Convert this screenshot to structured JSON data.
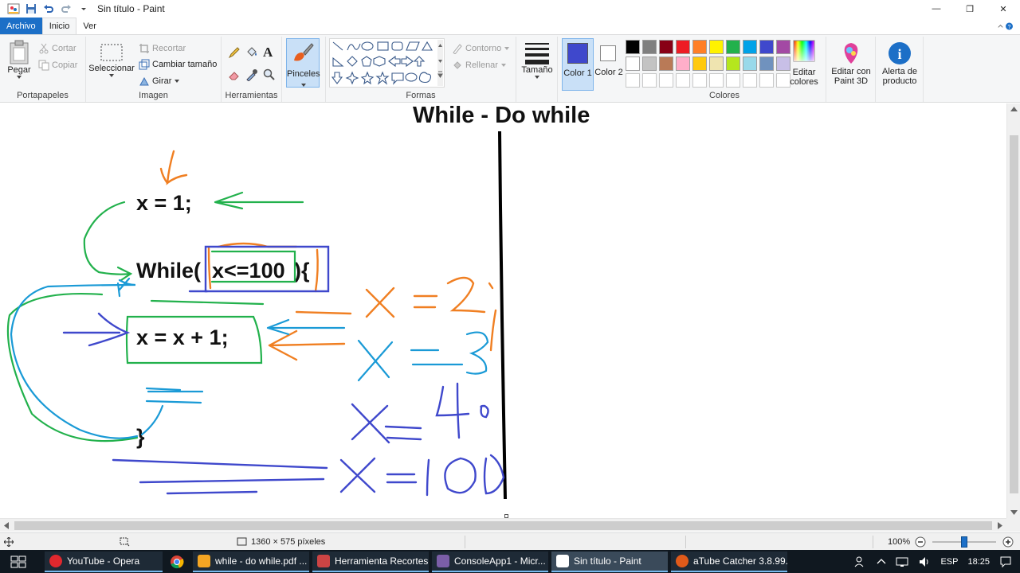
{
  "window": {
    "title": "Sin título - Paint",
    "controls": {
      "minimize": "—",
      "maximize": "❐",
      "close": "✕"
    }
  },
  "tabs": {
    "file": "Archivo",
    "home": "Inicio",
    "view": "Ver"
  },
  "ribbon": {
    "clipboard": {
      "paste": "Pegar",
      "cut": "Cortar",
      "copy": "Copiar",
      "label": "Portapapeles"
    },
    "image": {
      "select": "Seleccionar",
      "crop": "Recortar",
      "resize": "Cambiar tamaño",
      "rotate": "Girar",
      "label": "Imagen"
    },
    "tools": {
      "label": "Herramientas",
      "text_tool": "A"
    },
    "brushes": {
      "label": "Pinceles"
    },
    "shapes": {
      "outline": "Contorno",
      "fill": "Rellenar",
      "label": "Formas"
    },
    "size": {
      "label": "Tamaño"
    },
    "colors": {
      "color1": "Color 1",
      "color2": "Color 2",
      "edit": "Editar colores",
      "label": "Colores",
      "color1_value": "#3f48cc",
      "color2_value": "#ffffff",
      "palette_row1": [
        "#000000",
        "#7f7f7f",
        "#880015",
        "#ed1c24",
        "#ff7f27",
        "#fff200",
        "#22b14c",
        "#00a2e8",
        "#3f48cc",
        "#a349a4"
      ],
      "palette_row2": [
        "#ffffff",
        "#c3c3c3",
        "#b97a57",
        "#ffaec9",
        "#ffc90e",
        "#efe4b0",
        "#b5e61d",
        "#99d9ea",
        "#7092be",
        "#c8bfe7"
      ]
    },
    "paint3d": {
      "label": "Editar con Paint 3D"
    },
    "alert": {
      "label": "Alerta de producto"
    }
  },
  "canvas": {
    "title": "While -  Do while",
    "code_line1": "x = 1;",
    "code_while_keyword": "While(",
    "code_while_cond": "x<=100",
    "code_while_end": "){",
    "code_line3": "x = x + 1;",
    "code_close": "}"
  },
  "status": {
    "dimensions": "1360 × 575 píxeles",
    "zoom": "100%",
    "zoom_level_pct": 50
  },
  "taskbar": {
    "items": [
      "YouTube - Opera",
      "while - do while.pdf ...",
      "Herramienta Recortes",
      "ConsoleApp1 - Micr...",
      "Sin título - Paint",
      "aTube Catcher 3.8.99..."
    ],
    "language": "ESP",
    "time": "18:25"
  },
  "colors": {
    "accent": "#1c6fc7",
    "ink_green": "#22b14c",
    "ink_blue": "#3f48cc",
    "ink_cyan": "#1a9ad6",
    "ink_orange": "#f07f22"
  }
}
